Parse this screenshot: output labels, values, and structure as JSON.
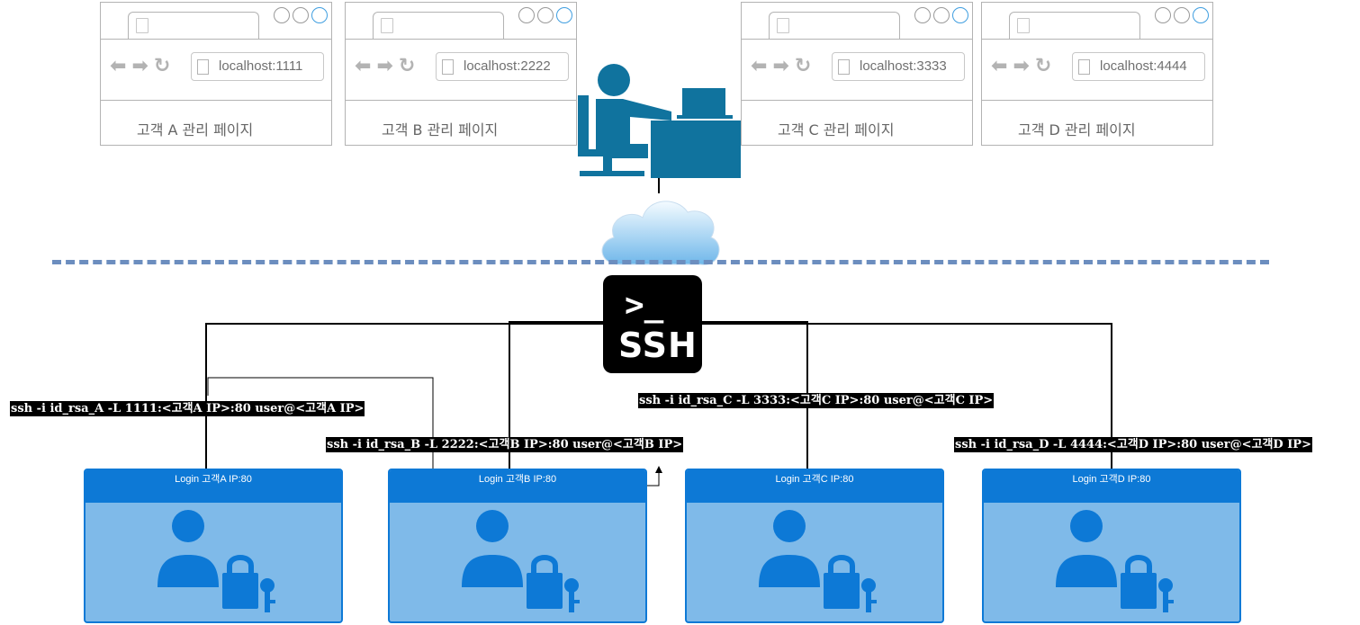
{
  "browsers": [
    {
      "url": "localhost:1111",
      "title": "고객 A 관리 페이지"
    },
    {
      "url": "localhost:2222",
      "title": "고객 B 관리 페이지"
    },
    {
      "url": "localhost:3333",
      "title": "고객 C 관리 페이지"
    },
    {
      "url": "localhost:4444",
      "title": "고객 D 관리 페이지"
    }
  ],
  "ssh_tile": {
    "prompt": ">_",
    "label": "SSH"
  },
  "commands": {
    "a": "ssh -i id_rsa_A -L 1111:<고객A IP>:80 user@<고객A IP>",
    "b": "ssh -i id_rsa_B -L 2222:<고객B IP>:80 user@<고객B IP>",
    "c": "ssh -i id_rsa_C -L 3333:<고객C IP>:80 user@<고객C IP>",
    "d": "ssh -i id_rsa_D -L 4444:<고객D IP>:80 user@<고객D IP>"
  },
  "logins": [
    {
      "title": "Login 고객A IP:80"
    },
    {
      "title": "Login 고객B IP:80"
    },
    {
      "title": "Login 고객C IP:80"
    },
    {
      "title": "Login 고객D IP:80"
    }
  ],
  "colors": {
    "teal": "#10739e",
    "panel": "#7fbae9",
    "panel_header": "#0d79d6",
    "dash": "#6c8ebf"
  }
}
